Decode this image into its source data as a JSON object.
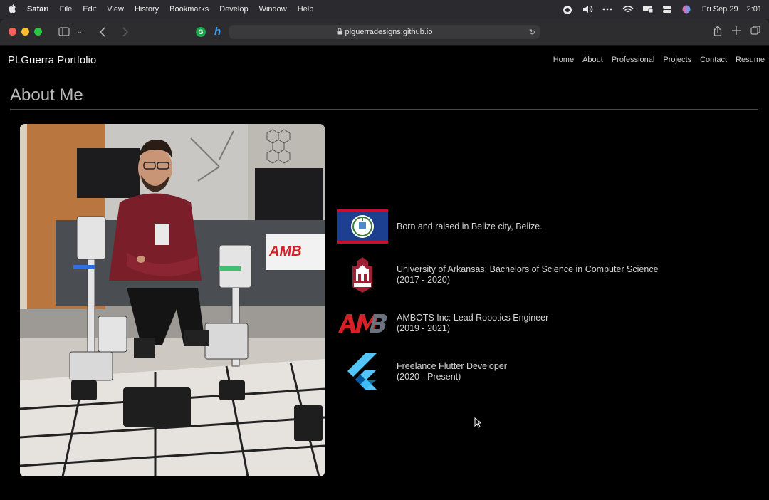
{
  "menubar": {
    "app_name": "Safari",
    "items": [
      "File",
      "Edit",
      "View",
      "History",
      "Bookmarks",
      "Develop",
      "Window",
      "Help"
    ],
    "date": "Fri Sep 29",
    "time": "2:01"
  },
  "browser": {
    "url": "plguerradesigns.github.io",
    "extension_g": "G"
  },
  "site": {
    "brand": "PLGuerra Portfolio",
    "nav": [
      "Home",
      "About",
      "Professional",
      "Projects",
      "Contact",
      "Resume"
    ],
    "section_title": "About Me",
    "facts": [
      {
        "line1": "Born and raised in Belize city, Belize.",
        "line2": "",
        "logo": "belize-flag-icon"
      },
      {
        "line1": "University of Arkansas: Bachelors of Science in Computer Science",
        "line2": "(2017 - 2020)",
        "logo": "arkansas-seal-icon"
      },
      {
        "line1": "AMBOTS Inc: Lead Robotics Engineer",
        "line2": "(2019 - 2021)",
        "logo": "ambots-logo-icon"
      },
      {
        "line1": "Freelance Flutter Developer",
        "line2": "(2020 - Present)",
        "logo": "flutter-logo-icon"
      }
    ],
    "ambots_sign_text": "AMB"
  },
  "colors": {
    "page_bg": "#000000",
    "belize_blue": "#1d3f8f",
    "belize_red": "#c8102e",
    "ambots_red": "#d62027",
    "ambots_gray": "#6b7280",
    "flutter_light": "#54c5f8",
    "flutter_dark": "#01579b"
  }
}
